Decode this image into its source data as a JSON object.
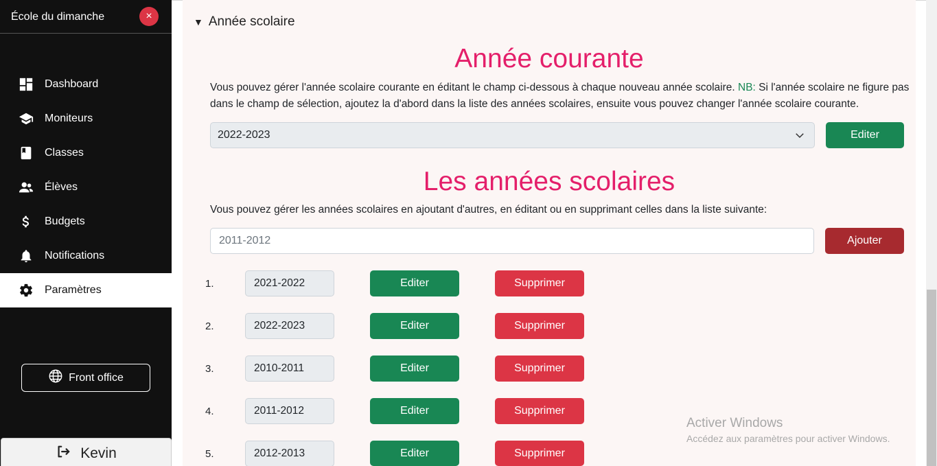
{
  "sidebar": {
    "title": "École du dimanche",
    "close_label": "×",
    "items": [
      {
        "label": "Dashboard",
        "icon": "dashboard-icon"
      },
      {
        "label": "Moniteurs",
        "icon": "graduation-cap-icon"
      },
      {
        "label": "Classes",
        "icon": "book-icon"
      },
      {
        "label": "Élèves",
        "icon": "users-icon"
      },
      {
        "label": "Budgets",
        "icon": "dollar-icon"
      },
      {
        "label": "Notifications",
        "icon": "bell-icon"
      },
      {
        "label": "Paramètres",
        "icon": "gear-icon",
        "active": true
      }
    ],
    "front_office_label": "Front office",
    "user_name": "Kevin"
  },
  "main": {
    "section_summary": "Année scolaire",
    "current_year": {
      "title": "Année courante",
      "description_part1": "Vous pouvez gérer l'année scolaire courante en éditant le champ ci-dessous à chaque nouveau année scolaire. ",
      "nb_label": "NB:",
      "description_part2": " Si l'année scolaire ne figure pas dans le champ de sélection, ajoutez la d'abord dans la liste des années scolaires, ensuite vous pouvez changer l'année scolaire courante.",
      "selected_value": "2022-2023",
      "edit_label": "Editer"
    },
    "years_list": {
      "title": "Les années scolaires",
      "description": "Vous pouvez gérer les années scolaires en ajoutant d'autres, en éditant ou en supprimant celles dans la liste suivante:",
      "input_placeholder": "2011-2012",
      "add_label": "Ajouter",
      "edit_label": "Editer",
      "delete_label": "Supprimer",
      "rows": [
        {
          "num": "1.",
          "year": "2021-2022"
        },
        {
          "num": "2.",
          "year": "2022-2023"
        },
        {
          "num": "3.",
          "year": "2010-2011"
        },
        {
          "num": "4.",
          "year": "2011-2012"
        },
        {
          "num": "5.",
          "year": "2012-2013"
        }
      ]
    }
  },
  "watermark": {
    "title": "Activer Windows",
    "subtitle": "Accédez aux paramètres pour activer Windows."
  },
  "colors": {
    "accent_pink": "#e41f6a",
    "green": "#198754",
    "red": "#dc3545",
    "dark_red": "#a72a2f",
    "sidebar_bg": "#111111"
  }
}
